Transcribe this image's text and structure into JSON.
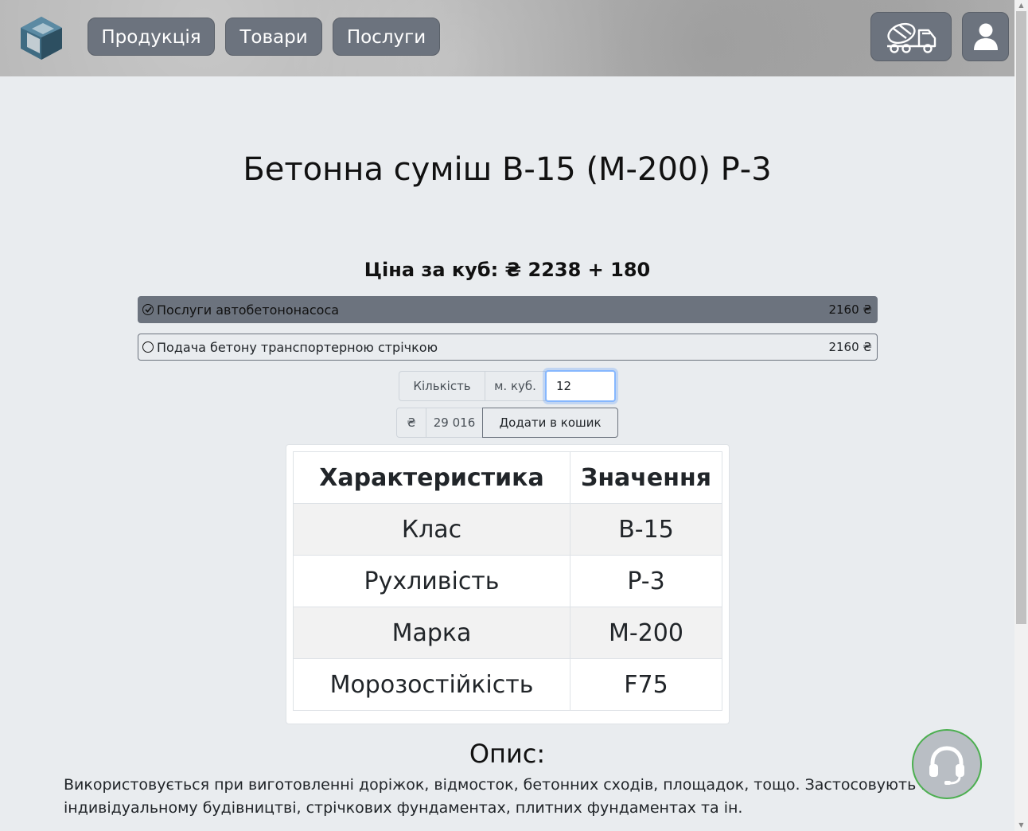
{
  "header": {
    "nav": [
      {
        "label": "Продукція"
      },
      {
        "label": "Товари"
      },
      {
        "label": "Послуги"
      }
    ]
  },
  "product": {
    "title": "Бетонна суміш В-15 (М-200) Р-3",
    "price_label": "Ціна за куб: ₴ 2238 + 180",
    "options": [
      {
        "label": "Послуги автобетононасоса",
        "price": "2160 ₴",
        "selected": true
      },
      {
        "label": "Подача бетону транспортерною стрічкою",
        "price": "2160 ₴",
        "selected": false
      }
    ],
    "quantity_label": "Кількість",
    "unit_label": "м. куб.",
    "quantity_value": "12",
    "currency_symbol": "₴",
    "total": "29 016",
    "add_to_cart": "Додати в кошик"
  },
  "specs": {
    "headers": [
      "Характеристика",
      "Значення"
    ],
    "rows": [
      {
        "name": "Клас",
        "value": "B-15"
      },
      {
        "name": "Рухливість",
        "value": "P-3"
      },
      {
        "name": "Марка",
        "value": "M-200"
      },
      {
        "name": "Морозостійкість",
        "value": "F75"
      }
    ]
  },
  "description": {
    "heading": "Опис:",
    "text": "Використовується при виготовленні доріжок, відмосток, бетонних сходів, площадок, тощо. Застосовують в індивідуальному будівництві, стрічкових фундаментах, плитних фундаментах та ін."
  },
  "colors": {
    "nav_button": "#6c737e",
    "page_bg": "#e9ecef",
    "support_ring": "#4caf50"
  },
  "icons": [
    "logo-cube-icon",
    "concrete-mixer-truck-icon",
    "user-icon",
    "check-circle-icon",
    "empty-circle-icon",
    "headset-support-icon"
  ]
}
